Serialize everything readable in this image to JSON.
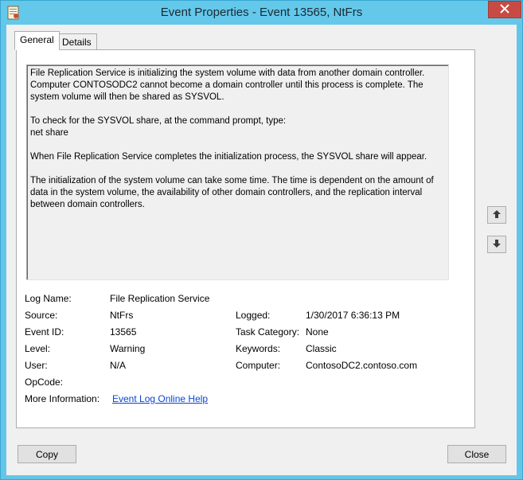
{
  "window": {
    "title": "Event Properties - Event 13565, NtFrs"
  },
  "tabs": [
    {
      "label": "General"
    },
    {
      "label": "Details"
    }
  ],
  "description": {
    "p1": "File Replication Service is initializing the system volume with data from another domain controller. Computer CONTOSODC2 cannot become a domain controller until this process is complete. The system volume will then be shared as SYSVOL.",
    "p2a": "To check for the SYSVOL share, at the command prompt, type:",
    "p2b": "net share",
    "p3": "When File Replication Service completes the initialization process, the SYSVOL share will appear.",
    "p4": "The initialization of the system volume can take some time. The time is dependent on the amount of data in the system volume, the availability of other domain controllers, and the replication interval between domain controllers."
  },
  "fields": {
    "log_name": {
      "label": "Log Name:",
      "value": "File Replication Service"
    },
    "source": {
      "label": "Source:",
      "value": "NtFrs"
    },
    "logged": {
      "label": "Logged:",
      "value": "1/30/2017 6:36:13 PM"
    },
    "event_id": {
      "label": "Event ID:",
      "value": "13565"
    },
    "task_category": {
      "label": "Task Category:",
      "value": "None"
    },
    "level": {
      "label": "Level:",
      "value": "Warning"
    },
    "keywords": {
      "label": "Keywords:",
      "value": "Classic"
    },
    "user": {
      "label": "User:",
      "value": "N/A"
    },
    "computer": {
      "label": "Computer:",
      "value": "ContosoDC2.contoso.com"
    },
    "opcode": {
      "label": "OpCode:",
      "value": ""
    },
    "more_info": {
      "label": "More Information:",
      "link": "Event Log Online Help"
    }
  },
  "buttons": {
    "copy": "Copy",
    "close": "Close"
  },
  "icons": {
    "app": "event-properties-icon",
    "close": "close-icon",
    "up": "arrow-up-icon",
    "down": "arrow-down-icon"
  },
  "colors": {
    "titlebar": "#64c8ea",
    "close_button": "#c74b44",
    "link": "#0645d6"
  }
}
